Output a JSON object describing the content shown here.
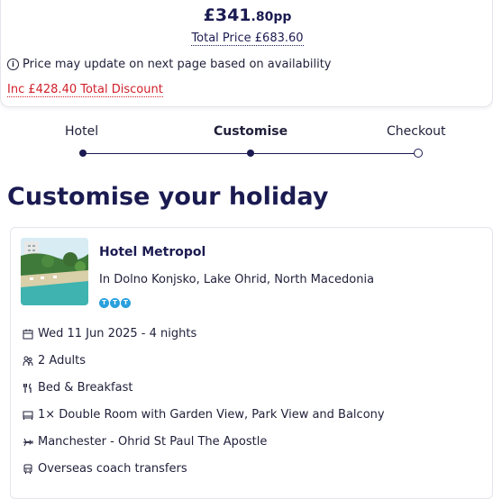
{
  "price": {
    "amount_main": "£341",
    "amount_decimal": ".80pp",
    "total": "Total Price £683.60",
    "availability_note": "Price may update on next page based on availability",
    "discount": "Inc £428.40 Total Discount"
  },
  "stepper": {
    "steps": [
      {
        "label": "Hotel",
        "state": "done"
      },
      {
        "label": "Customise",
        "state": "active"
      },
      {
        "label": "Checkout",
        "state": "upcoming"
      }
    ]
  },
  "page_title": "Customise your holiday",
  "hotel": {
    "name": "Hotel Metropol",
    "location": "In Dolno Konjsko, Lake Ohrid, North Macedonia",
    "rating_icon_letter": "T",
    "details": [
      {
        "icon": "calendar-icon",
        "text": "Wed 11 Jun 2025 - 4 nights"
      },
      {
        "icon": "people-icon",
        "text": "2 Adults"
      },
      {
        "icon": "cutlery-icon",
        "text": "Bed & Breakfast"
      },
      {
        "icon": "bed-icon",
        "text": "1× Double Room with Garden View, Park View and Balcony"
      },
      {
        "icon": "plane-icon",
        "text": "Manchester - Ohrid St Paul The Apostle"
      },
      {
        "icon": "bus-icon",
        "text": "Overseas coach transfers"
      }
    ]
  },
  "colors": {
    "brand_navy": "#1b1b52",
    "discount_red": "#d0202a",
    "tripadvisor_blue": "#2aa0dd"
  }
}
